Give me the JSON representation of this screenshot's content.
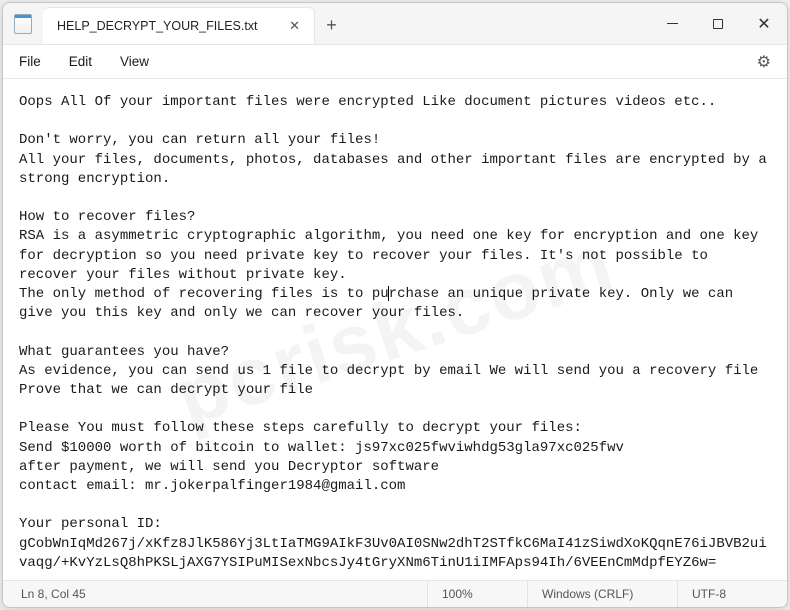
{
  "tab": {
    "title": "HELP_DECRYPT_YOUR_FILES.txt"
  },
  "menu": {
    "file": "File",
    "edit": "Edit",
    "view": "View"
  },
  "body": {
    "l1": "Oops All Of your important files were encrypted Like document pictures videos etc..",
    "l2": "",
    "l3": "Don't worry, you can return all your files!",
    "l4": "All your files, documents, photos, databases and other important files are encrypted by a strong encryption.",
    "l5": "",
    "l6": "How to recover files?",
    "l7": "RSA is a asymmetric cryptographic algorithm, you need one key for encryption and one key for decryption so you need private key to recover your files. It's not possible to recover your files without private key.",
    "l8a": "The only method of recovering files is to pu",
    "l8b": "rchase an unique private key. Only we can give you this key and only we can recover your files.",
    "l9": "",
    "l10": "What guarantees you have?",
    "l11": "As evidence, you can send us 1 file to decrypt by email We will send you a recovery file Prove that we can decrypt your file",
    "l12": "",
    "l13": "Please You must follow these steps carefully to decrypt your files:",
    "l14": "Send $10000 worth of bitcoin to wallet: js97xc025fwviwhdg53gla97xc025fwv",
    "l15": "after payment, we will send you Decryptor software",
    "l16": "contact email: mr.jokerpalfinger1984@gmail.com",
    "l17": "",
    "l18": "Your personal ID:",
    "l19": "gCobWnIqMd267j/xKfz8JlK586Yj3LtIaTMG9AIkF3Uv0AI0SNw2dhT2STfkC6MaI41zSiwdXoKQqnE76iJBVB2uivaqg/+KvYzLsQ8hPKSLjAXG7YSIPuMISexNbcsJy4tGryXNm6TinU1iIMFAps94Ih/6VEEnCmMdpfEYZ6w="
  },
  "status": {
    "position": "Ln 8, Col 45",
    "zoom": "100%",
    "eol": "Windows (CRLF)",
    "encoding": "UTF-8"
  },
  "watermark": "pcrisk.com"
}
